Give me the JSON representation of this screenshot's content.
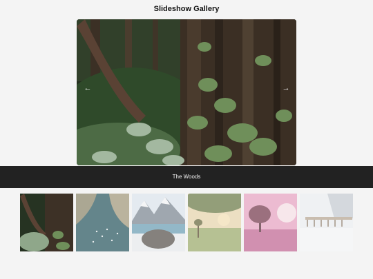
{
  "gallery": {
    "title": "Slideshow Gallery",
    "caption": "The Woods",
    "prev_icon": "chevron-left-icon",
    "next_icon": "chevron-right-icon",
    "thumbnails": [
      {
        "subject": "woods",
        "active": true
      },
      {
        "subject": "coast-aerial",
        "active": false
      },
      {
        "subject": "mountain-lake-rock",
        "active": false
      },
      {
        "subject": "misty-meadow-sunrise",
        "active": false
      },
      {
        "subject": "pink-field-tree",
        "active": false
      },
      {
        "subject": "snowy-village",
        "active": false
      }
    ]
  },
  "colors": {
    "background": "#f4f4f4",
    "caption_bar": "#222222",
    "caption_text": "#f2f2f2"
  }
}
